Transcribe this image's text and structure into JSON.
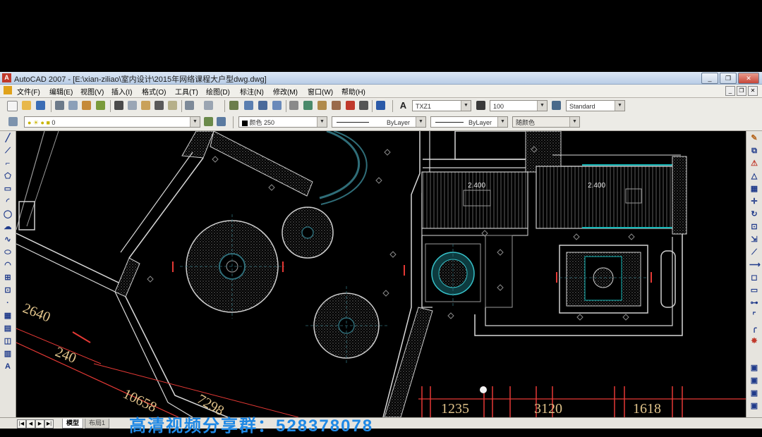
{
  "window": {
    "title": "AutoCAD 2007 - [E:\\xian-ziliao\\室内设计\\2015年网络课程大户型dwg.dwg]",
    "app_icon": "A"
  },
  "menu": [
    "文件(F)",
    "编辑(E)",
    "视图(V)",
    "插入(I)",
    "格式(O)",
    "工具(T)",
    "绘图(D)",
    "标注(N)",
    "修改(M)",
    "窗口(W)",
    "帮助(H)"
  ],
  "toolbar": {
    "text_style": "TXZ1",
    "dim_style": "100",
    "table_style": "Standard"
  },
  "properties": {
    "layer": "0",
    "color": "颜色 250",
    "linetype": "ByLayer",
    "lineweight": "ByLayer",
    "plotstyle": "随颜色"
  },
  "drawing": {
    "dims": {
      "d2640": "2640",
      "d240": "240",
      "d10658": "10658",
      "d7298": "7298",
      "d1235": "1235",
      "d3120": "3120",
      "d1618": "1618"
    },
    "levels": {
      "left": "2.400",
      "right": "2.400"
    }
  },
  "tabs": {
    "model": "模型",
    "layout": "布局1"
  },
  "overlay_text": "高清视频分享群：528378078",
  "colors": {
    "canvas": "#000000",
    "cyan": "#36c0c8",
    "dim_red": "#e53935",
    "accent_teal": "#14b8b8"
  }
}
